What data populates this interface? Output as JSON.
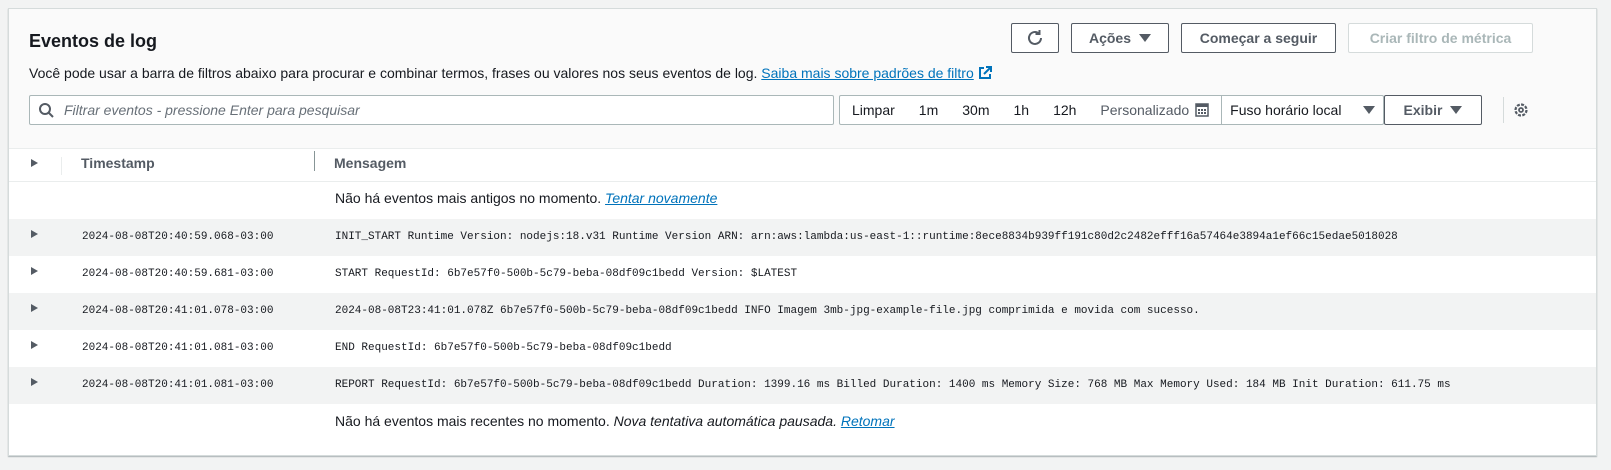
{
  "header": {
    "title": "Eventos de log",
    "description": "Você pode usar a barra de filtros abaixo para procurar e combinar termos, frases ou valores nos seus eventos de log.",
    "learn_more_link": "Saiba mais sobre padrões de filtro"
  },
  "toolbar": {
    "actions_label": "Ações",
    "follow_label": "Começar a seguir",
    "metric_filter_label": "Criar filtro de métrica"
  },
  "search": {
    "placeholder": "Filtrar eventos - pressione Enter para pesquisar"
  },
  "time_range": {
    "clear": "Limpar",
    "options": [
      "1m",
      "30m",
      "1h",
      "12h"
    ],
    "custom": "Personalizado",
    "timezone": "Fuso horário local",
    "display": "Exibir"
  },
  "columns": {
    "timestamp": "Timestamp",
    "message": "Mensagem"
  },
  "status_top": {
    "text": "Não há eventos mais antigos no momento.",
    "link": "Tentar novamente"
  },
  "status_bottom": {
    "text": "Não há eventos mais recentes no momento.",
    "italic": "Nova tentativa automática pausada.",
    "link": "Retomar"
  },
  "events": [
    {
      "timestamp": "2024-08-08T20:40:59.068-03:00",
      "message": "INIT_START Runtime Version: nodejs:18.v31 Runtime Version ARN: arn:aws:lambda:us-east-1::runtime:8ece8834b939ff191c80d2c2482efff16a57464e3894a1ef66c15edae5018028"
    },
    {
      "timestamp": "2024-08-08T20:40:59.681-03:00",
      "message": "START RequestId: 6b7e57f0-500b-5c79-beba-08df09c1bedd Version: $LATEST"
    },
    {
      "timestamp": "2024-08-08T20:41:01.078-03:00",
      "message": "2024-08-08T23:41:01.078Z 6b7e57f0-500b-5c79-beba-08df09c1bedd INFO Imagem 3mb-jpg-example-file.jpg comprimida e movida com sucesso."
    },
    {
      "timestamp": "2024-08-08T20:41:01.081-03:00",
      "message": "END RequestId: 6b7e57f0-500b-5c79-beba-08df09c1bedd"
    },
    {
      "timestamp": "2024-08-08T20:41:01.081-03:00",
      "message": "REPORT RequestId: 6b7e57f0-500b-5c79-beba-08df09c1bedd Duration: 1399.16 ms Billed Duration: 1400 ms Memory Size: 768 MB Max Memory Used: 184 MB Init Duration: 611.75 ms"
    }
  ]
}
